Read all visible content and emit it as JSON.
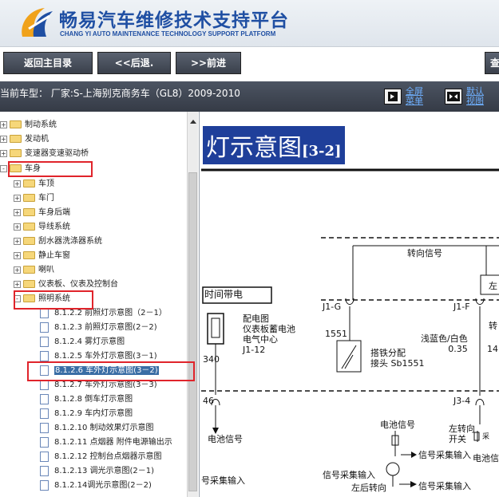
{
  "header": {
    "title": "畅易汽车维修技术支持平台",
    "subtitle": "CHANG YI AUTO MAINTENANCE TECHNOLOGY SUPPORT PLATFORM"
  },
  "nav": {
    "back_label": "返回主目录",
    "prev_label": "<<后退.",
    "next_label": ">>前进",
    "query_label": "查"
  },
  "infobar": {
    "car_model": "当前车型： 厂家:S-上海别克商务车（GL8）2009-2010",
    "full_menu": "全屏\n菜单",
    "default_view": "默认\n视图"
  },
  "tree": {
    "items": [
      {
        "label": "制动系统",
        "type": "folder",
        "expander": "+"
      },
      {
        "label": "发动机",
        "type": "folder",
        "expander": "+"
      },
      {
        "label": "变速器变速驱动桥",
        "type": "folder",
        "expander": "+"
      },
      {
        "label": "车身",
        "type": "folder",
        "expander": "-"
      },
      {
        "label": "车顶",
        "type": "folder",
        "expander": "+"
      },
      {
        "label": "车门",
        "type": "folder",
        "expander": "+"
      },
      {
        "label": "车身后端",
        "type": "folder",
        "expander": "+"
      },
      {
        "label": "导线系统",
        "type": "folder",
        "expander": "+"
      },
      {
        "label": "刮水器洗涤器系统",
        "type": "folder",
        "expander": "+"
      },
      {
        "label": "静止车窗",
        "type": "folder",
        "expander": "+"
      },
      {
        "label": "喇叭",
        "type": "folder",
        "expander": "+"
      },
      {
        "label": "仪表板、仪表及控制台",
        "type": "folder",
        "expander": "+"
      },
      {
        "label": "照明系统",
        "type": "folder",
        "expander": "-"
      },
      {
        "label": "8.1.2.2 前照灯示意图（2－1）",
        "type": "doc"
      },
      {
        "label": "8.1.2.3 前照灯示意图(2－2)",
        "type": "doc"
      },
      {
        "label": "8.1.2.4 雾灯示意图",
        "type": "doc"
      },
      {
        "label": "8.1.2.5 车外灯示意图(3－1)",
        "type": "doc"
      },
      {
        "label": "8.1.2.6 车外灯示意图(3－2)",
        "type": "doc"
      },
      {
        "label": "8.1.2.7 车外灯示意图(3－3)",
        "type": "doc"
      },
      {
        "label": "8.1.2.8 倒车灯示意图",
        "type": "doc"
      },
      {
        "label": "8.1.2.9 车内灯示意图",
        "type": "doc"
      },
      {
        "label": "8.1.2.10 制动效果灯示意图",
        "type": "doc"
      },
      {
        "label": "8.1.2.11 点烟器 附件电源输出示",
        "type": "doc"
      },
      {
        "label": "8.1.2.12 控制台点烟器示意图",
        "type": "doc"
      },
      {
        "label": "8.1.2.13 调光示意图(2－1)",
        "type": "doc"
      },
      {
        "label": "8.1.2.14调光示意图(2－2)",
        "type": "doc"
      }
    ]
  },
  "diagram": {
    "title": "灯示意图",
    "code": "[3-2]",
    "labels": {
      "turn_signal": "转向信号",
      "left_cut": "左",
      "run_time": "时间带电",
      "j1g": "J1-G",
      "j1f": "J1-F",
      "turn_cut": "转",
      "power_dist": "配电图\n仪表板蓄电池\n电气中心\nJ1-12",
      "n1551": "1551",
      "ground": "搭铁分配\n接头 Sb1551",
      "wire_color": "浅蓝色/白色\n0.35",
      "n14": "14",
      "n340": "340",
      "j34": "J3-4",
      "n46": "46",
      "battery_sig_left": "电池信号",
      "battery_sig_mid": "电池信号",
      "left_turn_switch": "左转向\n开关",
      "collect_cut": "采",
      "collect_input_1": "信号采集输入",
      "battery_sig_right": "电池信",
      "collect_input_left": "号采集输入",
      "collect_input_2": "信号采集输入",
      "left_rear_turn": "左后转向",
      "collect_input_3": "信号采集输入"
    }
  }
}
